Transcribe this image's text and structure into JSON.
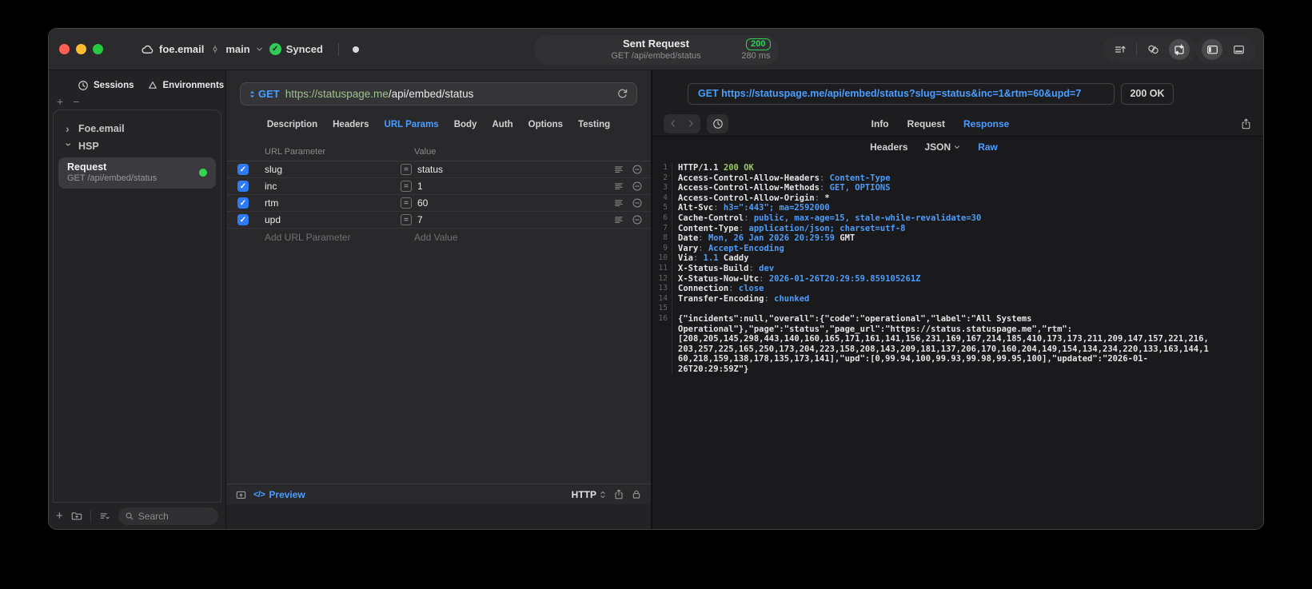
{
  "colors": {
    "accent_blue": "#4a9eff",
    "status_green": "#32d74b",
    "badge_green": "#30d158",
    "mono_value_blue": "#4f9cf8",
    "mono_status_green": "#9ac862",
    "url_host_green": "#9fbf8f",
    "checkbox_blue": "#2f7bf5"
  },
  "icons": {
    "cloud-icon": "cloud",
    "branch-icon": "git-commit",
    "chevron-down-icon": "chevron-down",
    "synced-check-icon": "check-circle",
    "unsaved-indicator-dot": "dot",
    "export-list-icon": "lines-arrow-up",
    "sync-requests-icon": "linked-loops",
    "import-export-icon": "box-arrows",
    "panel-left-icon": "sidebar-left",
    "panel-bottom-icon": "panel-bottom",
    "sessions-clock-icon": "clock",
    "environments-icon": "triangle",
    "add-icon": "plus",
    "remove-icon": "minus",
    "new-group-icon": "folder-plus",
    "sort-filter-icon": "list-chevron",
    "search-icon": "magnifier",
    "method-stepper-icon": "up-down-triangles",
    "resend-icon": "refresh",
    "equals-icon": "equals-box",
    "drag-handle-icon": "justify-lines",
    "remove-row-icon": "minus-circle",
    "collapse-editor-icon": "pane-arrow-up",
    "code-icon": "angle-brackets",
    "protocol-stepper-icon": "chevrons-up-down",
    "share-icon": "square-arrow-up",
    "lock-icon": "padlock",
    "history-back-icon": "chevron-left",
    "history-forward-icon": "chevron-right",
    "history-clock-icon": "clock"
  },
  "titlebar": {
    "project": "foe.email",
    "branch": "main",
    "sync_status": "Synced",
    "title": "Sent Request",
    "subtitle": "GET /api/embed/status",
    "status_code": "200",
    "duration": "280 ms"
  },
  "sidebar": {
    "tabs": [
      {
        "label": "Sessions"
      },
      {
        "label": "Environments"
      }
    ],
    "tree": [
      {
        "label": "Foe.email",
        "state": "collapsed"
      },
      {
        "label": "HSP",
        "state": "expanded"
      }
    ],
    "request_item": {
      "title": "Request",
      "subtitle": "GET /api/embed/status",
      "selected": true
    },
    "search_placeholder": "Search"
  },
  "request_panel": {
    "method": "GET",
    "url_host": "https://statuspage.me",
    "url_path": "/api/embed/status",
    "tabs": [
      "Description",
      "Headers",
      "URL Params",
      "Body",
      "Auth",
      "Options",
      "Testing"
    ],
    "active_tab": "URL Params",
    "params_table": {
      "columns": [
        "URL Parameter",
        "Value"
      ],
      "rows": [
        {
          "name": "slug",
          "value": "status",
          "enabled": true
        },
        {
          "name": "inc",
          "value": "1",
          "enabled": true
        },
        {
          "name": "rtm",
          "value": "60",
          "enabled": true
        },
        {
          "name": "upd",
          "value": "7",
          "enabled": true
        }
      ],
      "add_name_placeholder": "Add URL Parameter",
      "add_value_placeholder": "Add Value"
    },
    "footer": {
      "preview_label": "Preview",
      "code_glyph": "</>",
      "protocol": "HTTP"
    }
  },
  "response_panel": {
    "request_line": "GET https://statuspage.me/api/embed/status?slug=status&inc=1&rtm=60&upd=7",
    "status": "200 OK",
    "tabs": [
      "Info",
      "Request",
      "Response"
    ],
    "active_tab": "Response",
    "view_tabs": [
      "Headers",
      "JSON",
      "Raw"
    ],
    "active_view": "Raw",
    "lines": [
      {
        "num": "1",
        "seg": [
          [
            "HTTP/1.1 ",
            "w"
          ],
          [
            "200 OK",
            "g"
          ]
        ]
      },
      {
        "num": "2",
        "seg": [
          [
            "Access-Control-Allow-Headers",
            "k"
          ],
          [
            ": ",
            "p"
          ],
          [
            "Content-Type",
            "v"
          ]
        ]
      },
      {
        "num": "3",
        "seg": [
          [
            "Access-Control-Allow-Methods",
            "k"
          ],
          [
            ": ",
            "p"
          ],
          [
            "GET, OPTIONS",
            "v"
          ]
        ]
      },
      {
        "num": "4",
        "seg": [
          [
            "Access-Control-Allow-Origin",
            "k"
          ],
          [
            ": ",
            "p"
          ],
          [
            "*",
            "w"
          ]
        ]
      },
      {
        "num": "5",
        "seg": [
          [
            "Alt-Svc",
            "k"
          ],
          [
            ": ",
            "p"
          ],
          [
            "h3=\":443\"; ma=2592000",
            "v"
          ]
        ]
      },
      {
        "num": "6",
        "seg": [
          [
            "Cache-Control",
            "k"
          ],
          [
            ": ",
            "p"
          ],
          [
            "public, max-age=15, stale-while-revalidate=30",
            "v"
          ]
        ]
      },
      {
        "num": "7",
        "seg": [
          [
            "Content-Type",
            "k"
          ],
          [
            ": ",
            "p"
          ],
          [
            "application/json; charset=utf-8",
            "v"
          ]
        ]
      },
      {
        "num": "8",
        "seg": [
          [
            "Date",
            "k"
          ],
          [
            ": ",
            "p"
          ],
          [
            "Mon, 26 Jan 2026 20:29:59 ",
            "v"
          ],
          [
            "GMT",
            "w"
          ]
        ]
      },
      {
        "num": "9",
        "seg": [
          [
            "Vary",
            "k"
          ],
          [
            ": ",
            "p"
          ],
          [
            "Accept-Encoding",
            "v"
          ]
        ]
      },
      {
        "num": "10",
        "seg": [
          [
            "Via",
            "k"
          ],
          [
            ": ",
            "p"
          ],
          [
            "1.1 ",
            "v"
          ],
          [
            "Caddy",
            "w"
          ]
        ]
      },
      {
        "num": "11",
        "seg": [
          [
            "X-Status-Build",
            "k"
          ],
          [
            ": ",
            "p"
          ],
          [
            "dev",
            "v"
          ]
        ]
      },
      {
        "num": "12",
        "seg": [
          [
            "X-Status-Now-Utc",
            "k"
          ],
          [
            ": ",
            "p"
          ],
          [
            "2026-01-26T20:29:59.859105261Z",
            "v"
          ]
        ]
      },
      {
        "num": "13",
        "seg": [
          [
            "Connection",
            "k"
          ],
          [
            ": ",
            "p"
          ],
          [
            "close",
            "v"
          ]
        ]
      },
      {
        "num": "14",
        "seg": [
          [
            "Transfer-Encoding",
            "k"
          ],
          [
            ": ",
            "p"
          ],
          [
            "chunked",
            "v"
          ]
        ]
      },
      {
        "num": "15",
        "seg": []
      },
      {
        "num": "16",
        "seg": [
          [
            "{\"incidents\":null,\"overall\":{\"code\":\"operational\",\"label\":\"All Systems Operational\"},\"page\":\"status\",\"page_url\":\"https://status.statuspage.me\",\"rtm\":[208,205,145,298,443,140,160,165,171,161,141,156,231,169,167,214,185,410,173,173,211,209,147,157,221,216,203,257,225,165,250,173,204,223,158,208,143,209,181,137,206,170,160,204,149,154,134,234,220,133,163,144,160,218,159,138,178,135,173,141],\"upd\":[0,99.94,100,99.93,99.98,99.95,100],\"updated\":\"2026-01-26T20:29:59Z\"}",
            "w"
          ]
        ]
      }
    ]
  }
}
